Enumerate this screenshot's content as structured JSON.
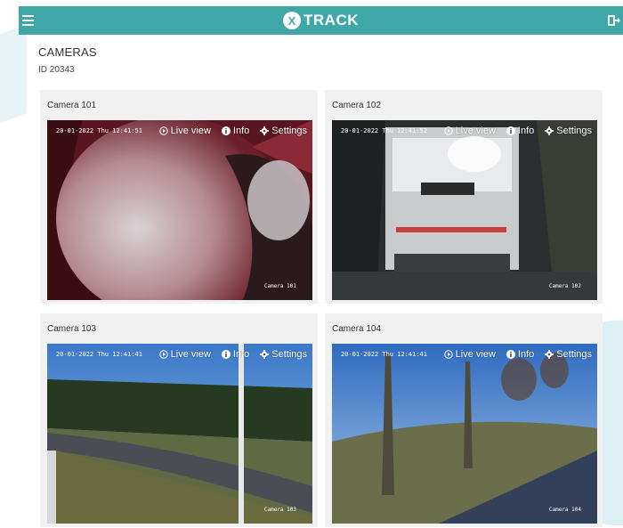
{
  "app": {
    "brand_mark": "X",
    "brand_name": "TRACK"
  },
  "page": {
    "title": "CAMERAS",
    "id_label": "ID 20343"
  },
  "actions": {
    "live_view": "Live view",
    "info": "Info",
    "settings": "Settings"
  },
  "cameras": [
    {
      "title": "Camera 101",
      "osd_time": "20-01-2022 Thu 12:41:51",
      "osd_name": "Camera 101"
    },
    {
      "title": "Camera 102",
      "osd_time": "20-01-2022 Thu 12:41:52",
      "osd_name": "Camera 102"
    },
    {
      "title": "Camera 103",
      "osd_time": "20-01-2022 Thu 12:41:41",
      "osd_name": "Camera 103"
    },
    {
      "title": "Camera 104",
      "osd_time": "20-01-2022 Thu 12:41:41",
      "osd_name": "Camera 104"
    }
  ],
  "colors": {
    "topbar": "#3fa7a7",
    "card_bg": "#f1f1f1"
  },
  "icons": {
    "menu": "hamburger-icon",
    "logout": "logout-icon",
    "live_view": "play-circle-icon",
    "info": "info-icon",
    "settings": "gear-icon"
  }
}
